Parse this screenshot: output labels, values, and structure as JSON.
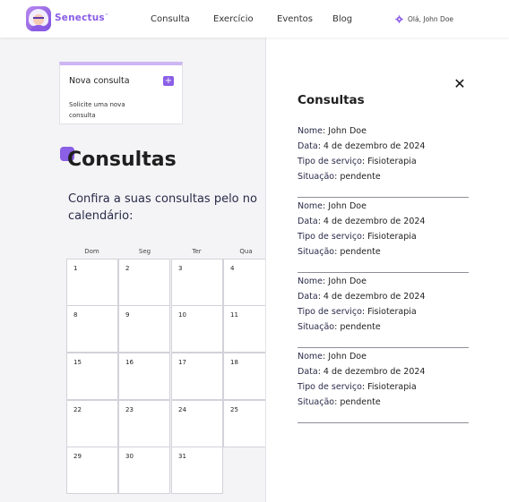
{
  "brand": {
    "name": "Senectus",
    "mark": "™"
  },
  "nav": {
    "links": [
      "Consulta",
      "Exercício",
      "Eventos",
      "Blog"
    ],
    "user_greeting": "Olá, John Doe"
  },
  "card": {
    "title": "Nova consulta",
    "description": "Solicite uma nova consulta",
    "plus_icon": "+"
  },
  "main": {
    "title": "Consultas",
    "subtitle": "Confira a suas consultas pelo no calendário:"
  },
  "calendar": {
    "weekdays": [
      "Dom",
      "Seg",
      "Ter",
      "Qua"
    ],
    "rows": [
      [
        "1",
        "2",
        "3",
        "4"
      ],
      [
        "8",
        "9",
        "10",
        "11"
      ],
      [
        "15",
        "16",
        "17",
        "18"
      ],
      [
        "22",
        "23",
        "24",
        "25"
      ],
      [
        "29",
        "30",
        "31",
        ""
      ]
    ]
  },
  "panel": {
    "title": "Consultas",
    "close_icon": "✕",
    "labels": {
      "name": "Nome",
      "date": "Data",
      "service": "Tipo de serviço",
      "status": "Situação"
    },
    "appointments": [
      {
        "name": "John Doe",
        "date": "4 de dezembro de 2024",
        "service": "Fisioterapia",
        "status": "pendente"
      },
      {
        "name": "John Doe",
        "date": "4 de dezembro de 2024",
        "service": "Fisioterapia",
        "status": "pendente"
      },
      {
        "name": "John Doe",
        "date": "4 de dezembro de 2024",
        "service": "Fisioterapia",
        "status": "pendente"
      },
      {
        "name": "John Doe",
        "date": "4 de dezembro de 2024",
        "service": "Fisioterapia",
        "status": "pendente"
      }
    ]
  },
  "colors": {
    "accent": "#8b5fe6",
    "accent_light": "#cdb6f3",
    "panel_bg": "#ffffff",
    "page_bg": "#f4f4f6"
  }
}
